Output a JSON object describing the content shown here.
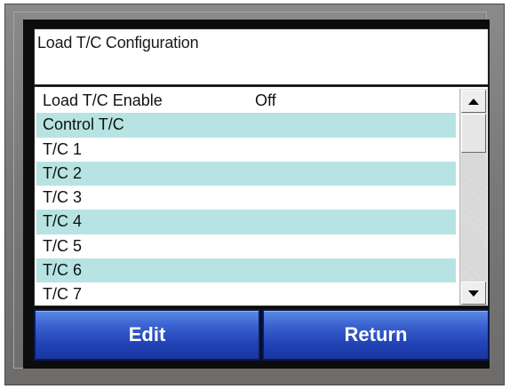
{
  "header": {
    "title": "Load T/C Configuration"
  },
  "list": {
    "rows": [
      {
        "label": "Load T/C Enable",
        "value": "Off"
      },
      {
        "label": "Control T/C",
        "value": ""
      },
      {
        "label": "T/C 1",
        "value": ""
      },
      {
        "label": "T/C 2",
        "value": ""
      },
      {
        "label": "T/C 3",
        "value": ""
      },
      {
        "label": "T/C 4",
        "value": ""
      },
      {
        "label": "T/C 5",
        "value": ""
      },
      {
        "label": "T/C 6",
        "value": ""
      },
      {
        "label": "T/C 7",
        "value": ""
      }
    ]
  },
  "scrollbar": {
    "up_icon": "arrow-up-icon",
    "down_icon": "arrow-down-icon"
  },
  "buttons": {
    "edit_label": "Edit",
    "return_label": "Return"
  },
  "colors": {
    "row_alt": "#b7e3e3",
    "button_blue": "#2345b8",
    "bezel": "#7a7876"
  }
}
